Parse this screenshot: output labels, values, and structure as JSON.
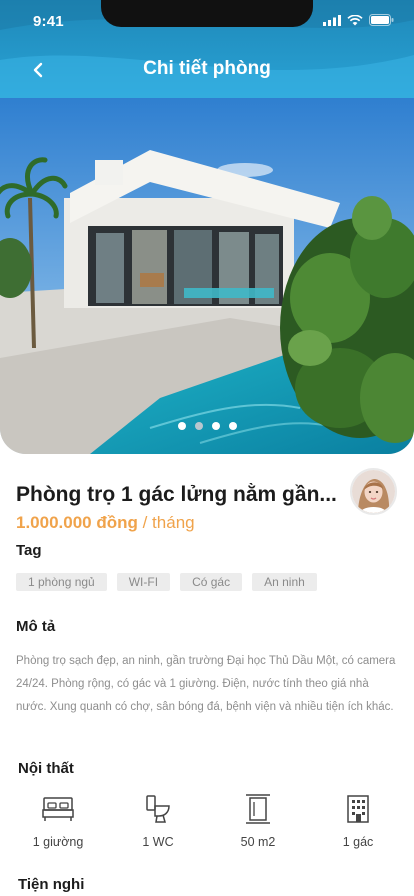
{
  "status_bar": {
    "time": "9:41"
  },
  "header": {
    "title": "Chi tiết phòng"
  },
  "gallery": {
    "slide_count": 4,
    "active_index": 0
  },
  "listing": {
    "title": "Phòng trọ 1 gác lửng nằm gần...",
    "price": "1.000.000 đồng",
    "price_unit": " / tháng"
  },
  "tags_section": {
    "label": "Tag",
    "items": [
      "1 phòng ngủ",
      "WI-FI",
      "Có gác",
      "An ninh"
    ]
  },
  "description_section": {
    "label": "Mô tả",
    "text": "Phòng trọ sạch đẹp, an ninh, gần trường Đại học Thủ Dầu Một, có camera 24/24. Phòng rộng, có gác và 1 giường. Điện, nước tính theo giá nhà nước. Xung quanh có chợ, sân bóng đá, bệnh viện và nhiều tiện ích khác."
  },
  "furniture_section": {
    "label": "Nội thất",
    "items": [
      {
        "icon": "bed-icon",
        "label": "1 giường"
      },
      {
        "icon": "toilet-icon",
        "label": "1 WC"
      },
      {
        "icon": "area-icon",
        "label": "50 m2"
      },
      {
        "icon": "building-icon",
        "label": "1 gác"
      }
    ]
  },
  "facilities_section": {
    "label": "Tiện nghi"
  },
  "colors": {
    "header": "#2aa3d6",
    "price": "#f0a34b",
    "tag_bg": "#ececec"
  }
}
